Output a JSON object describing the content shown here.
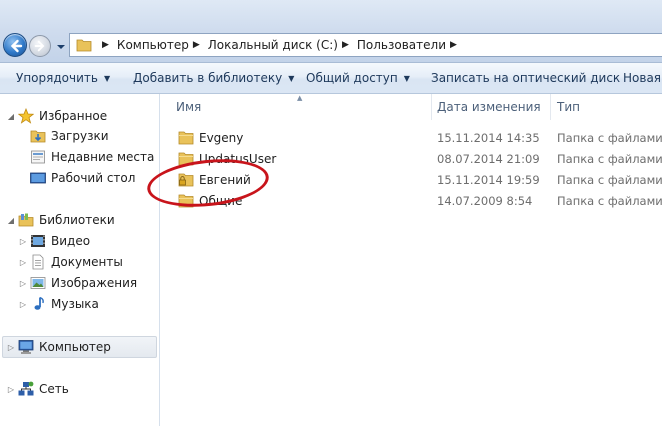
{
  "address": {
    "crumbs": [
      "Компьютер",
      "Локальный диск (C:)",
      "Пользователи"
    ]
  },
  "toolbar": {
    "organize": "Упорядочить",
    "add_to_library": "Добавить в библиотеку",
    "share": "Общий доступ",
    "burn": "Записать на оптический диск",
    "new_folder": "Новая п"
  },
  "nav": {
    "favorites": {
      "label": "Избранное",
      "items": [
        "Загрузки",
        "Недавние места",
        "Рабочий стол"
      ]
    },
    "libraries": {
      "label": "Библиотеки",
      "items": [
        "Видео",
        "Документы",
        "Изображения",
        "Музыка"
      ]
    },
    "computer": "Компьютер",
    "network": "Сеть"
  },
  "columns": {
    "name": "Имя",
    "date": "Дата изменения",
    "type": "Тип"
  },
  "files": [
    {
      "name": "Evgeny",
      "date": "15.11.2014 14:35",
      "type": "Папка с файлами",
      "locked": false
    },
    {
      "name": "UpdatusUser",
      "date": "08.07.2014 21:09",
      "type": "Папка с файлами",
      "locked": false
    },
    {
      "name": "Евгений",
      "date": "15.11.2014 19:59",
      "type": "Папка с файлами",
      "locked": true
    },
    {
      "name": "Общие",
      "date": "14.07.2009 8:54",
      "type": "Папка с файлами",
      "locked": false
    }
  ],
  "colors": {
    "folder": "#e9c25a",
    "annotation": "#c8141b",
    "link": "#1e395b"
  }
}
